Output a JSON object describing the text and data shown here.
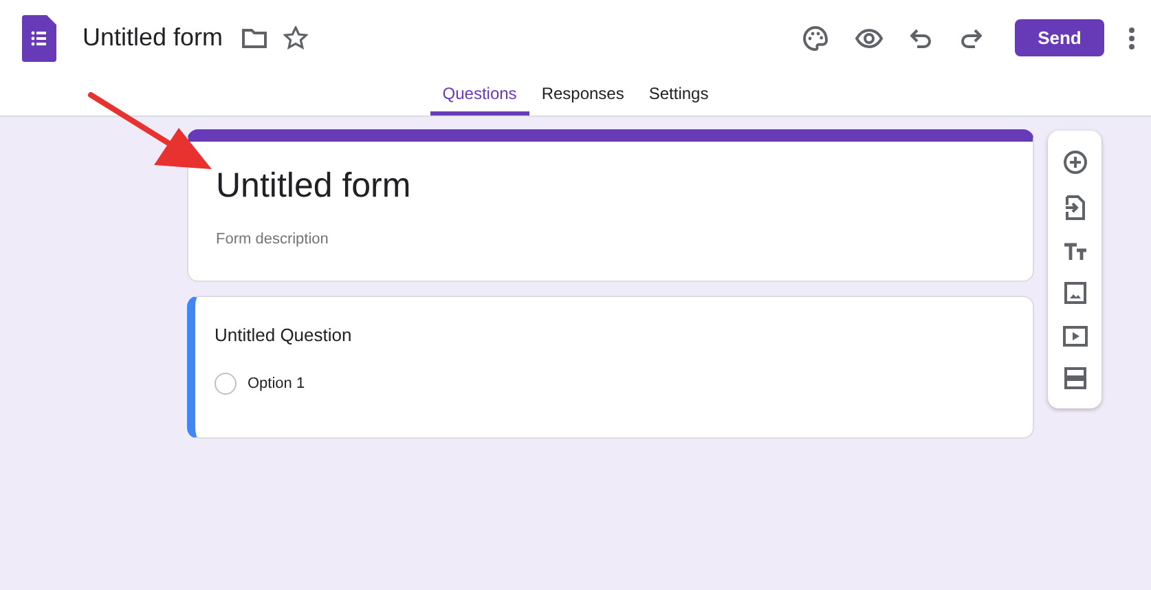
{
  "header": {
    "title": "Untitled form",
    "send_button": "Send"
  },
  "tabs": [
    {
      "label": "Questions",
      "selected": true
    },
    {
      "label": "Responses",
      "selected": false
    },
    {
      "label": "Settings",
      "selected": false
    }
  ],
  "form": {
    "title": "Untitled form",
    "description": {
      "placeholder": "Form description"
    }
  },
  "question": {
    "title": "Untitled Question",
    "options": [
      {
        "label": "Option 1",
        "selected": false
      }
    ]
  }
}
